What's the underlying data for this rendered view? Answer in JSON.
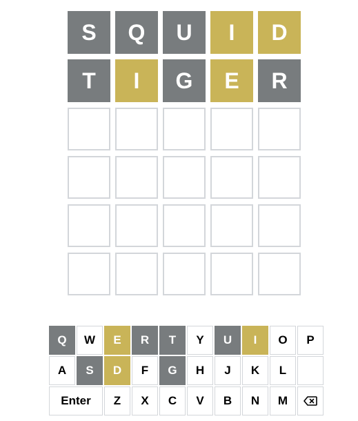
{
  "board": {
    "rows": [
      [
        {
          "letter": "S",
          "state": "absent"
        },
        {
          "letter": "Q",
          "state": "absent"
        },
        {
          "letter": "U",
          "state": "absent"
        },
        {
          "letter": "I",
          "state": "present"
        },
        {
          "letter": "D",
          "state": "present"
        }
      ],
      [
        {
          "letter": "T",
          "state": "absent"
        },
        {
          "letter": "I",
          "state": "present"
        },
        {
          "letter": "G",
          "state": "absent"
        },
        {
          "letter": "E",
          "state": "present"
        },
        {
          "letter": "R",
          "state": "absent"
        }
      ],
      [
        {
          "letter": "",
          "state": "empty"
        },
        {
          "letter": "",
          "state": "empty"
        },
        {
          "letter": "",
          "state": "empty"
        },
        {
          "letter": "",
          "state": "empty"
        },
        {
          "letter": "",
          "state": "empty"
        }
      ],
      [
        {
          "letter": "",
          "state": "empty"
        },
        {
          "letter": "",
          "state": "empty"
        },
        {
          "letter": "",
          "state": "empty"
        },
        {
          "letter": "",
          "state": "empty"
        },
        {
          "letter": "",
          "state": "empty"
        }
      ],
      [
        {
          "letter": "",
          "state": "empty"
        },
        {
          "letter": "",
          "state": "empty"
        },
        {
          "letter": "",
          "state": "empty"
        },
        {
          "letter": "",
          "state": "empty"
        },
        {
          "letter": "",
          "state": "empty"
        }
      ],
      [
        {
          "letter": "",
          "state": "empty"
        },
        {
          "letter": "",
          "state": "empty"
        },
        {
          "letter": "",
          "state": "empty"
        },
        {
          "letter": "",
          "state": "empty"
        },
        {
          "letter": "",
          "state": "empty"
        }
      ]
    ]
  },
  "keyboard": {
    "rows": [
      [
        {
          "label": "Q",
          "state": "absent"
        },
        {
          "label": "W",
          "state": "unused"
        },
        {
          "label": "E",
          "state": "present"
        },
        {
          "label": "R",
          "state": "absent"
        },
        {
          "label": "T",
          "state": "absent"
        },
        {
          "label": "Y",
          "state": "unused"
        },
        {
          "label": "U",
          "state": "absent"
        },
        {
          "label": "I",
          "state": "present"
        },
        {
          "label": "O",
          "state": "unused"
        },
        {
          "label": "P",
          "state": "unused"
        }
      ],
      [
        {
          "label": "A",
          "state": "unused"
        },
        {
          "label": "S",
          "state": "absent"
        },
        {
          "label": "D",
          "state": "present"
        },
        {
          "label": "F",
          "state": "unused"
        },
        {
          "label": "G",
          "state": "absent"
        },
        {
          "label": "H",
          "state": "unused"
        },
        {
          "label": "J",
          "state": "unused"
        },
        {
          "label": "K",
          "state": "unused"
        },
        {
          "label": "L",
          "state": "unused"
        },
        {
          "label": "",
          "state": "blank"
        }
      ],
      [
        {
          "label": "Enter",
          "state": "unused",
          "kind": "enter"
        },
        {
          "label": "Z",
          "state": "unused"
        },
        {
          "label": "X",
          "state": "unused"
        },
        {
          "label": "C",
          "state": "unused"
        },
        {
          "label": "V",
          "state": "unused"
        },
        {
          "label": "B",
          "state": "unused"
        },
        {
          "label": "N",
          "state": "unused"
        },
        {
          "label": "M",
          "state": "unused"
        },
        {
          "label": "",
          "state": "unused",
          "kind": "backspace",
          "icon": "backspace-icon"
        }
      ]
    ]
  },
  "colors": {
    "absent": "#787c7e",
    "present": "#c9b458",
    "correct": "#6aaa64",
    "empty_border": "#d3d6da"
  }
}
